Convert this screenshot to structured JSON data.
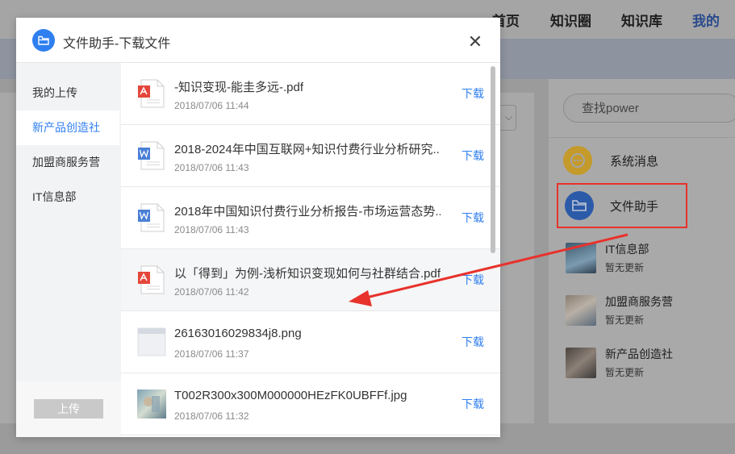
{
  "nav": {
    "items": [
      "首页",
      "知识圈",
      "知识库",
      "我的"
    ]
  },
  "right": {
    "search_placeholder": "查找power",
    "system_msg": "系统消息",
    "file_helper": "文件助手",
    "groups": [
      {
        "name": "IT信息部",
        "sub": "暂无更新"
      },
      {
        "name": "加盟商服务营",
        "sub": "暂无更新"
      },
      {
        "name": "新产品创造社",
        "sub": "暂无更新"
      }
    ]
  },
  "modal": {
    "title": "文件助手-下载文件",
    "sidebar": [
      "我的上传",
      "新产品创造社",
      "加盟商服务营",
      "IT信息部"
    ],
    "upload_label": "上传",
    "download_label": "下载",
    "files": [
      {
        "name": "-知识变现-能圭多远-.pdf",
        "date": "2018/07/06 11:44",
        "type": "pdf"
      },
      {
        "name": "2018-2024年中国互联网+知识付费行业分析研究...",
        "date": "2018/07/06 11:43",
        "type": "word"
      },
      {
        "name": "2018年中国知识付费行业分析报告-市场运营态势...",
        "date": "2018/07/06 11:43",
        "type": "word"
      },
      {
        "name": "以「得到」为例-浅析知识变现如何与社群结合.pdf",
        "date": "2018/07/06 11:42",
        "type": "pdf"
      },
      {
        "name": "26163016029834j8.png",
        "date": "2018/07/06 11:37",
        "type": "image-blank"
      },
      {
        "name": "T002R300x300M000000HEzFK0UBFFf.jpg",
        "date": "2018/07/06 11:32",
        "type": "image"
      }
    ]
  },
  "colors": {
    "accent": "#2f7ff0",
    "annotation": "#e8322c",
    "pdf": "#e5463b",
    "word": "#4a7fd6",
    "system": "#d4a528"
  }
}
